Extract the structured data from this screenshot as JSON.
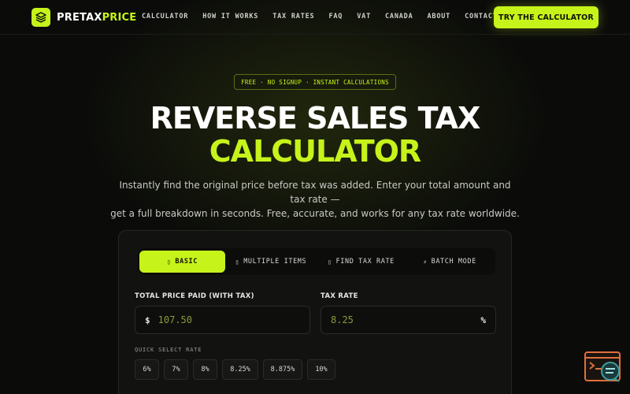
{
  "brand": {
    "name_part1": "PRETAX",
    "name_part2": "PRICE",
    "accent": "#c6f31a",
    "background": "#0b0c0a"
  },
  "nav": {
    "items": [
      "CALCULATOR",
      "HOW IT WORKS",
      "TAX RATES",
      "FAQ",
      "VAT",
      "CANADA",
      "ABOUT",
      "CONTACT"
    ],
    "cta_label": "TRY THE CALCULATOR"
  },
  "hero": {
    "badge": "FREE · NO SIGNUP · INSTANT CALCULATIONS",
    "title_line1": "REVERSE SALES TAX",
    "title_line2": "CALCULATOR",
    "subtitle_line1": "Instantly find the original price before tax was added. Enter your total amount and tax rate —",
    "subtitle_line2": "get a full breakdown in seconds. Free, accurate, and works for any tax rate worldwide."
  },
  "calculator": {
    "tabs": [
      {
        "label": "BASIC",
        "icon": "▯",
        "active": true
      },
      {
        "label": "MULTIPLE ITEMS",
        "icon": "▯",
        "active": false
      },
      {
        "label": "FIND TAX RATE",
        "icon": "▯",
        "active": false
      },
      {
        "label": "BATCH MODE",
        "icon": "⚡",
        "active": false
      }
    ],
    "total_label": "TOTAL PRICE PAID (WITH TAX)",
    "currency_symbol": "$",
    "total_placeholder": "107.50",
    "rate_label": "TAX RATE",
    "rate_placeholder": "8.25",
    "rate_unit": "%",
    "quick_select_label": "QUICK SELECT RATE",
    "quick_rates": [
      "6%",
      "7%",
      "8%",
      "8.25%",
      "8.875%",
      "10%"
    ]
  },
  "widget": {
    "icon": "chat-help-icon"
  }
}
